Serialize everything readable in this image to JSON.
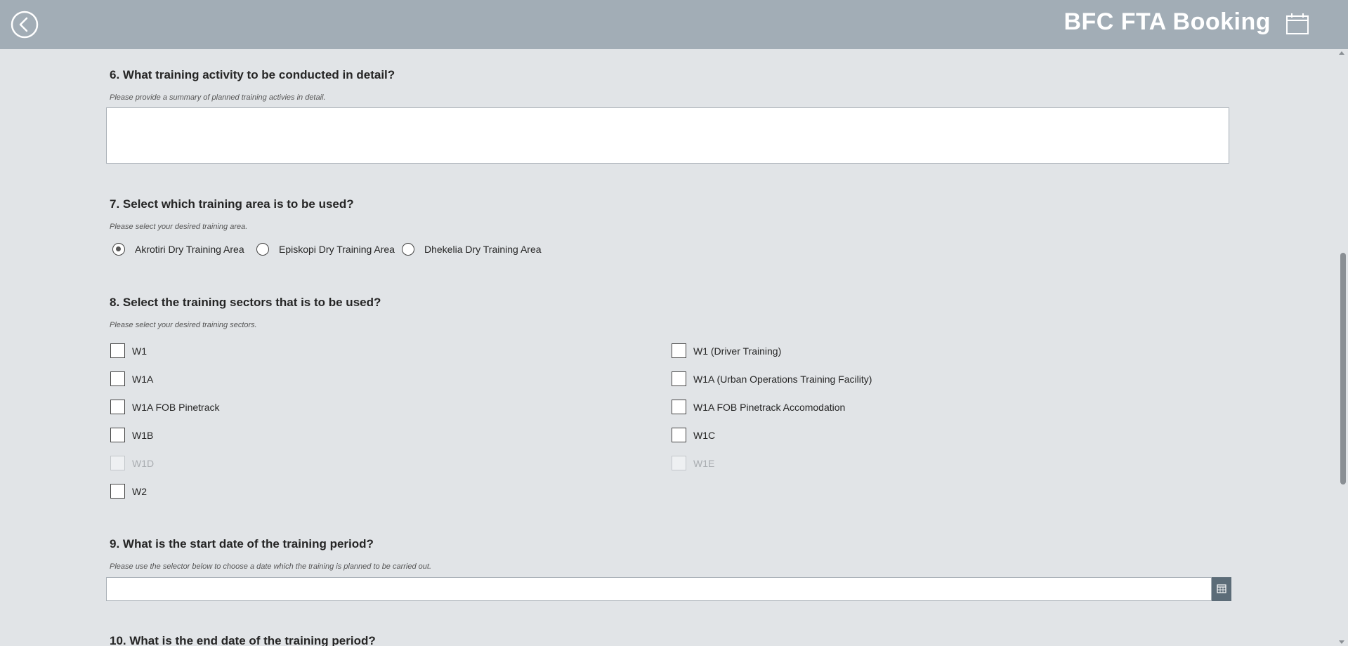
{
  "header": {
    "title": "BFC FTA Booking",
    "back_icon": "chevron-left-circle-icon",
    "calendar_icon": "calendar-icon",
    "background": "#a2adb6"
  },
  "q6": {
    "title": "6. What training activity to be conducted in detail?",
    "hint": "Please provide a summary of planned training activies in detail.",
    "value": ""
  },
  "q7": {
    "title": "7. Select which training area is to be used?",
    "hint": "Please select your desired training area.",
    "options": [
      {
        "label": "Akrotiri Dry Training Area",
        "selected": true
      },
      {
        "label": "Episkopi Dry Training Area",
        "selected": false
      },
      {
        "label": "Dhekelia Dry Training Area",
        "selected": false
      }
    ]
  },
  "q8": {
    "title": "8. Select the training sectors that is to be used?",
    "hint": "Please select your desired training sectors.",
    "left": [
      {
        "label": "W1",
        "checked": false,
        "disabled": false
      },
      {
        "label": "W1A",
        "checked": false,
        "disabled": false
      },
      {
        "label": "W1A FOB Pinetrack",
        "checked": false,
        "disabled": false
      },
      {
        "label": "W1B",
        "checked": false,
        "disabled": false
      },
      {
        "label": "W1D",
        "checked": false,
        "disabled": true
      },
      {
        "label": "W2",
        "checked": false,
        "disabled": false
      }
    ],
    "right": [
      {
        "label": "W1 (Driver Training)",
        "checked": false,
        "disabled": false
      },
      {
        "label": "W1A (Urban Operations Training Facility)",
        "checked": false,
        "disabled": false
      },
      {
        "label": "W1A FOB Pinetrack Accomodation",
        "checked": false,
        "disabled": false
      },
      {
        "label": "W1C",
        "checked": false,
        "disabled": false
      },
      {
        "label": "W1E",
        "checked": false,
        "disabled": true
      }
    ]
  },
  "q9": {
    "title": "9. What is the start date of the training period?",
    "hint": "Please use the selector below to choose a date which the training is planned to be carried out.",
    "value": "",
    "picker_icon": "calendar-picker-icon"
  },
  "q10": {
    "title": "10. What is the end date of the training period?"
  }
}
